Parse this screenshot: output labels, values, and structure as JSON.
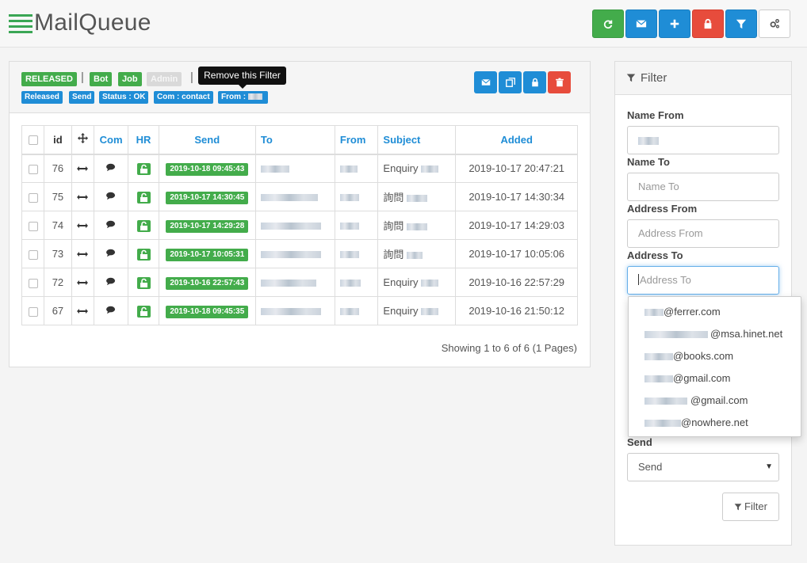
{
  "app": {
    "title": "MailQueue"
  },
  "toolbar": {
    "buttons": [
      {
        "name": "refresh",
        "icon": "refresh-icon",
        "color": "#43ac4b"
      },
      {
        "name": "mail",
        "icon": "envelope-icon",
        "color": "#1f8dd6"
      },
      {
        "name": "add",
        "icon": "plus-icon",
        "color": "#1f8dd6"
      },
      {
        "name": "lock",
        "icon": "lock-icon",
        "color": "#e74c3c"
      },
      {
        "name": "filter",
        "icon": "filter-icon",
        "color": "#1f8dd6"
      },
      {
        "name": "settings",
        "icon": "gears-icon",
        "color": "#ffffff"
      }
    ]
  },
  "main": {
    "status_labels": [
      "RELEASED",
      "Bot",
      "Job",
      "Admin"
    ],
    "filter_tags": [
      "Released",
      "Send",
      "Status : OK",
      "Com : contact",
      "From :"
    ],
    "tooltip": "Remove this Filter",
    "table": {
      "headers": [
        "id",
        "Com",
        "HR",
        "Send",
        "To",
        "From",
        "Subject",
        "Added"
      ],
      "rows": [
        {
          "id": "76",
          "send": "2019-10-18 09:45:43",
          "subject": "Enquiry",
          "added": "2019-10-17 20:47:21"
        },
        {
          "id": "75",
          "send": "2019-10-17 14:30:45",
          "subject": "詢問",
          "added": "2019-10-17 14:30:34"
        },
        {
          "id": "74",
          "send": "2019-10-17 14:29:28",
          "subject": "詢問",
          "added": "2019-10-17 14:29:03"
        },
        {
          "id": "73",
          "send": "2019-10-17 10:05:31",
          "subject": "詢問",
          "added": "2019-10-17 10:05:06"
        },
        {
          "id": "72",
          "send": "2019-10-16 22:57:43",
          "subject": "Enquiry",
          "added": "2019-10-16 22:57:29"
        },
        {
          "id": "67",
          "send": "2019-10-18 09:45:35",
          "subject": "Enquiry",
          "added": "2019-10-16 21:50:12"
        }
      ]
    },
    "pagination": "Showing 1 to 6 of 6 (1 Pages)"
  },
  "filter": {
    "title": "Filter",
    "name_from_label": "Name From",
    "name_to_label": "Name To",
    "name_to_placeholder": "Name To",
    "address_from_label": "Address From",
    "address_from_placeholder": "Address From",
    "address_to_label": "Address To",
    "address_to_placeholder": "Address To",
    "send_label": "Send",
    "send_value": "Send",
    "submit_label": "Filter"
  },
  "autocomplete": [
    "@ferrer.com",
    "@msa.hinet.net",
    "@books.com",
    "@gmail.com",
    "@gmail.com",
    "@nowhere.net"
  ]
}
